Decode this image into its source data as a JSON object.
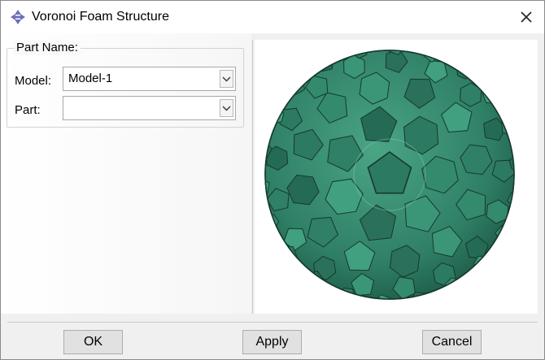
{
  "window": {
    "title": "Voronoi Foam Structure"
  },
  "icons": {
    "app": "diamond-app-icon",
    "close": "close-icon",
    "dropdown": "chevron-down-icon"
  },
  "form": {
    "group_title": "Part Name:",
    "model_label": "Model:",
    "model_value": "Model-1",
    "part_label": "Part:",
    "part_value": ""
  },
  "preview": {
    "fill_color": "#2f7f66",
    "edge_color": "#16392d"
  },
  "buttons": {
    "ok": "OK",
    "apply": "Apply",
    "cancel": "Cancel"
  }
}
